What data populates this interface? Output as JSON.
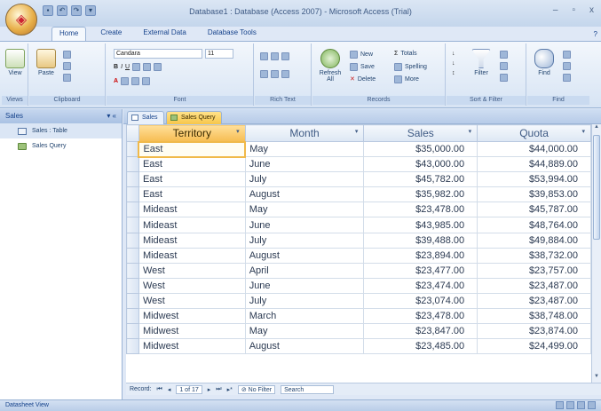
{
  "window": {
    "title": "Database1 : Database (Access 2007) - Microsoft Access (Trial)"
  },
  "window_controls": {
    "minimize": "–",
    "maximize": "▫",
    "close": "x"
  },
  "ribbon_tabs": [
    {
      "label": "Home",
      "active": true
    },
    {
      "label": "Create"
    },
    {
      "label": "External Data"
    },
    {
      "label": "Database Tools"
    }
  ],
  "ribbon": {
    "views": {
      "view_label": "View",
      "group_label": "Views"
    },
    "clipboard": {
      "paste_label": "Paste",
      "group_label": "Clipboard"
    },
    "font": {
      "font_name": "Candara",
      "font_size": "11",
      "group_label": "Font"
    },
    "rich_text": {
      "group_label": "Rich Text"
    },
    "records": {
      "refresh_label": "Refresh All",
      "new_label": "New",
      "save_label": "Save",
      "delete_label": "Delete",
      "totals_label": "Totals",
      "spelling_label": "Spelling",
      "more_label": "More",
      "group_label": "Records"
    },
    "sort_filter": {
      "filter_label": "Filter",
      "group_label": "Sort & Filter"
    },
    "find": {
      "find_label": "Find",
      "group_label": "Find"
    }
  },
  "nav_pane": {
    "header": "Sales",
    "items": [
      {
        "label": "Sales : Table"
      },
      {
        "label": "Sales Query"
      }
    ]
  },
  "doc_tabs": [
    {
      "label": "Sales"
    },
    {
      "label": "Sales Query",
      "active": true
    }
  ],
  "table": {
    "columns": [
      "Territory",
      "Month",
      "Sales",
      "Quota"
    ],
    "rows": [
      [
        "East",
        "May",
        "$35,000.00",
        "$44,000.00"
      ],
      [
        "East",
        "June",
        "$43,000.00",
        "$44,889.00"
      ],
      [
        "East",
        "July",
        "$45,782.00",
        "$53,994.00"
      ],
      [
        "East",
        "August",
        "$35,982.00",
        "$39,853.00"
      ],
      [
        "Mideast",
        "May",
        "$23,478.00",
        "$45,787.00"
      ],
      [
        "Mideast",
        "June",
        "$43,985.00",
        "$48,764.00"
      ],
      [
        "Mideast",
        "July",
        "$39,488.00",
        "$49,884.00"
      ],
      [
        "Mideast",
        "August",
        "$23,894.00",
        "$38,732.00"
      ],
      [
        "West",
        "April",
        "$23,477.00",
        "$23,757.00"
      ],
      [
        "West",
        "June",
        "$23,474.00",
        "$23,487.00"
      ],
      [
        "West",
        "July",
        "$23,074.00",
        "$23,487.00"
      ],
      [
        "Midwest",
        "March",
        "$23,478.00",
        "$38,748.00"
      ],
      [
        "Midwest",
        "May",
        "$23,847.00",
        "$23,874.00"
      ],
      [
        "Midwest",
        "August",
        "$23,485.00",
        "$24,499.00"
      ]
    ]
  },
  "record_nav": {
    "prefix": "Record:",
    "position": "1 of 17",
    "filter": "No Filter",
    "search": "Search"
  },
  "status_bar": {
    "text": "Datasheet View"
  }
}
